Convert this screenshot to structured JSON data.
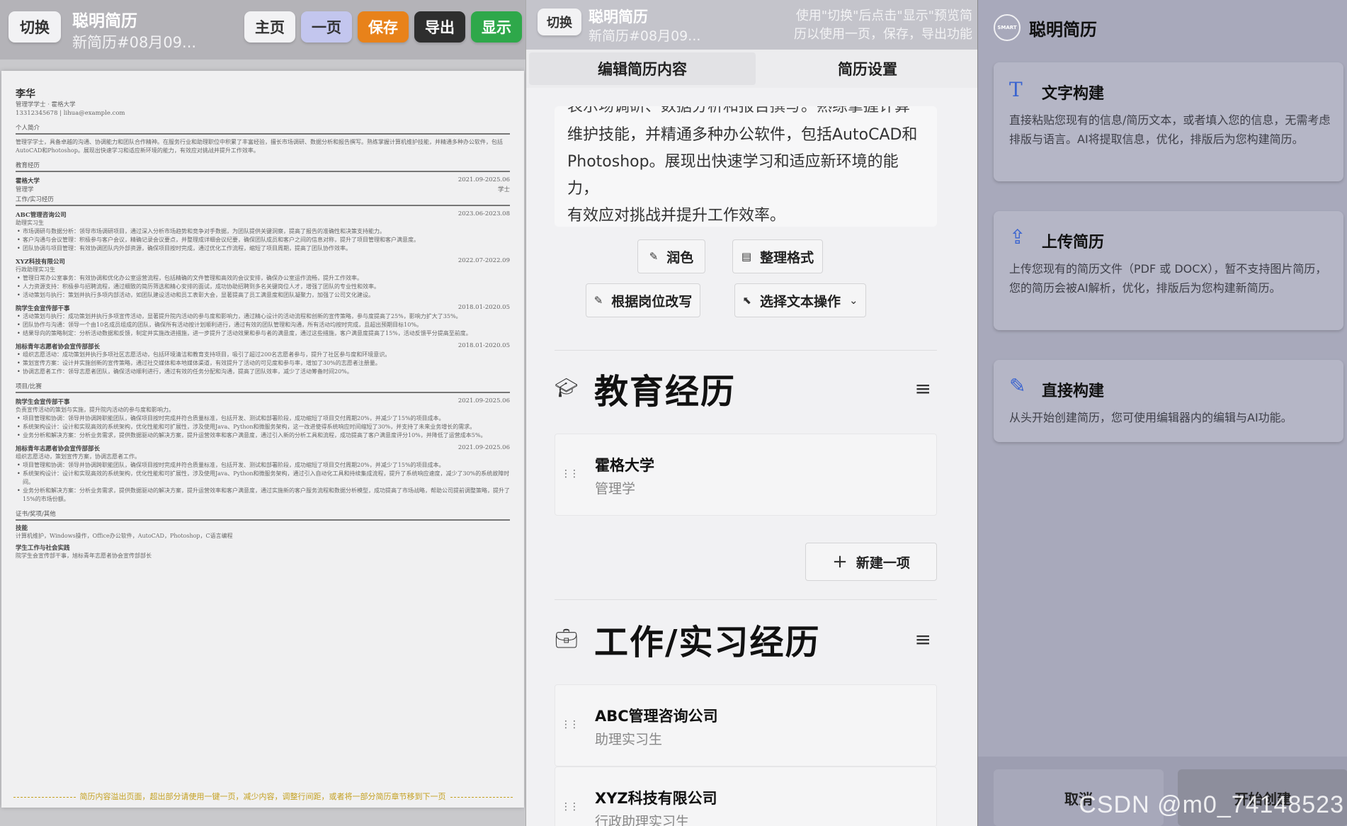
{
  "colors": {
    "save": "#e8821a",
    "export": "#2e2e2e",
    "show": "#2ea84a",
    "onepage": "#c3c6ee",
    "accent_icon": "#3a64d0",
    "footer_hint": "#c4a020"
  },
  "left": {
    "switch_label": "切换",
    "app_title": "聪明简历",
    "doc_name": "新简历#08月09...",
    "btn_home": "主页",
    "btn_onepage": "一页",
    "btn_save": "保存",
    "btn_export": "导出",
    "btn_show": "显示",
    "resume": {
      "name": "李华",
      "subtitle": "管理学学士 · 霍格大学",
      "contact": "13312345678 | lihua@example.com",
      "sec_profile": "个人简介",
      "profile": "管理学学士，具备卓越的沟通、协调能力和团队合作精神。在服务行业和助理职位中积累了丰富经验，擅长市场调研、数据分析和报告撰写。熟练掌握计算机维护技能，并精通多种办公软件，包括AutoCAD和Photoshop。展现出快速学习和适应新环境的能力，有效应对挑战并提升工作效率。",
      "sec_edu": "教育经历",
      "edu": [
        {
          "school": "霍格大学",
          "date": "2021.09-2025.06",
          "major": "管理学",
          "degree": "学士"
        }
      ],
      "sec_work": "工作/实习经历",
      "jobs": [
        {
          "company": "ABC管理咨询公司",
          "date": "2023.06-2023.08",
          "role": "助理实习生",
          "bullets": [
            "市场调研与数据分析：领导市场调研项目，通过深入分析市场趋势和竞争对手数据，为团队提供关键洞察，提高了报告的准确性和决策支持能力。",
            "客户沟通与会议管理：积极参与客户会议，精确记录会议要点，并整理成详细会议纪要，确保团队成员和客户之间的信息对称，提升了项目管理和客户满意度。",
            "团队协调与项目管理：有效协调团队内外部资源，确保项目按时完成，通过优化工作流程，缩短了项目周期，提高了团队协作效率。"
          ]
        },
        {
          "company": "XYZ科技有限公司",
          "date": "2022.07-2022.09",
          "role": "行政助理实习生",
          "bullets": [
            "管理日常办公室事务：有效协调和优化办公室运营流程，包括精确的文件管理和高效的会议安排，确保办公室运作流畅，提升工作效率。",
            "人力资源支持：积极参与招聘流程，通过细致的简历筛选和精心安排的面试，成功协助招聘到多名关键岗位人才，增强了团队的专业性和效率。",
            "活动策划与执行：策划并执行多项内部活动，如团队建设活动和员工表彰大会，显著提高了员工满意度和团队凝聚力，加强了公司文化建设。"
          ]
        },
        {
          "company": "院学生会宣传部干事",
          "date": "2018.01-2020.05",
          "role": "",
          "bullets": [
            "活动策划与执行：成功策划并执行多项宣传活动，显著提升院内活动的参与度和影响力，通过精心设计的活动流程和创新的宣传策略，参与度提高了25%，影响力扩大了35%。",
            "团队协作与沟通：领导一个由10名成员组成的团队，确保所有活动按计划顺利进行，通过有效的团队管理和沟通，所有活动均按时完成，且超出预期目标10%。",
            "结果导向的策略制定：分析活动数据和反馈，制定并实施改进措施，进一步提升了活动效果和参与者的满意度，通过这些措施，客户满意度提高了15%，活动反馈平分提高至前度。"
          ]
        },
        {
          "company": "旭标青年志愿者协会宣传部部长",
          "date": "2018.01-2020.05",
          "role": "",
          "bullets": [
            "组织志愿活动：成功策划并执行多项社区志愿活动，包括环境清洁和教育支持项目，吸引了超过200名志愿者参与，提升了社区参与度和环境意识。",
            "策划宣传方案：设计并实施创新的宣传策略，通过社交媒体和本地媒体渠道，有效提升了活动的可见度和参与率，增加了30%的志愿者注册量。",
            "协调志愿者工作：领导志愿者团队，确保活动顺利进行，通过有效的任务分配和沟通，提高了团队效率，减少了活动筹备时间20%。"
          ]
        }
      ],
      "sec_project": "项目/比赛",
      "projects": [
        {
          "title": "院学生会宣传部干事",
          "date": "2021.09-2025.06",
          "desc": "负责宣传活动的策划与实施，提升院内活动的参与度和影响力。",
          "bullets": [
            "项目管理和协调：领导并协调跨职能团队，确保项目按时完成并符合质量标准，包括开发、测试和部署阶段，成功缩短了项目交付周期20%，并减少了15%的项目成本。",
            "系统架构设计：设计和实现高效的系统架构，优化性能和可扩展性，涉及使用Java、Python和微服务架构，这一改进使得系统响应时间缩短了30%，并支持了未来业务增长的需求。",
            "业务分析和解决方案：分析业务需求，提供数据驱动的解决方案，提升运营效率和客户满意度，通过引入新的分析工具和流程，成功提高了客户满意度评分10%，并降低了运营成本5%。"
          ]
        },
        {
          "title": "旭标青年志愿者协会宣传部部长",
          "date": "2021.09-2025.06",
          "desc": "组织志愿活动，策划宣传方案，协调志愿者工作。",
          "bullets": [
            "项目管理和协调：领导并协调跨职能团队，确保项目按时完成并符合质量标准，包括开发、测试和部署阶段，成功缩短了项目交付周期20%，并减少了15%的项目成本。",
            "系统架构设计：设计和实现高效的系统架构，优化性能和可扩展性，涉及使用Java、Python和微服务架构，通过引入自动化工具和持续集成流程，提升了系统响应速度，减少了30%的系统故障时间。",
            "业务分析和解决方案：分析业务需求，提供数据驱动的解决方案，提升运营效率和客户满意度，通过实施新的客户服务流程和数据分析模型，成功提高了市场战略，帮助公司提前调整策略，提升了15%的市场份额。"
          ]
        }
      ],
      "sec_cert": "证书/奖项/其他",
      "skills_title": "技能",
      "skills": "计算机维护，Windows操作，Office办公软件，AutoCAD，Photoshop，C语言编程",
      "social_title": "学生工作与社会实践",
      "social": "院学生会宣传部干事，旭标青年志愿者协会宣传部部长",
      "footer_hint": "简历内容溢出页面，超出部分请使用一键一页，减少内容，调整行间距，或者将一部分简历章节移到下一页"
    }
  },
  "middle": {
    "switch_label": "切换",
    "app_title": "聪明简历",
    "doc_name": "新简历#08月09...",
    "hint_line1": "使用\"切换\"后点击\"显示\"预览简",
    "hint_line2": "历以使用一页，保存，导出功能",
    "tab_edit": "编辑简历内容",
    "tab_settings": "简历设置",
    "text_partial": "表示场调研、数据分析和报告撰写。熟练掌握计算机",
    "text_l1": "维护技能，并精通多种办公软件，包括AutoCAD和",
    "text_l2": "Photoshop。展现出快速学习和适应新环境的能力，",
    "text_l3": "有效应对挑战并提升工作效率。",
    "btn_polish": "润色",
    "btn_format": "整理格式",
    "btn_rewrite": "根据岗位改写",
    "btn_select_ops": "选择文本操作",
    "sec_edu_title": "教育经历",
    "edu_school": "霍格大学",
    "edu_major": "管理学",
    "btn_new_item": "新建一项",
    "sec_work_title": "工作/实习经历",
    "work1_company": "ABC管理咨询公司",
    "work1_role": "助理实习生",
    "work2_company": "XYZ科技有限公司",
    "work2_role": "行政助理实习生"
  },
  "right": {
    "logo_text": "SMART",
    "title": "聪明简历",
    "options": [
      {
        "icon": "text-icon",
        "title": "文字构建",
        "desc": "直接粘贴您现有的信息/简历文本，或者填入您的信息，无需考虑排版与语言。AI将提取信息，优化，排版后为您构建简历。"
      },
      {
        "icon": "upload-icon",
        "title": "上传简历",
        "desc": "上传您现有的简历文件（PDF 或 DOCX），暂不支持图片简历，您的简历会被AI解析，优化，排版后为您构建新简历。"
      },
      {
        "icon": "pencil-icon",
        "title": "直接构建",
        "desc": "从头开始创建简历，您可使用编辑器内的编辑与AI功能。"
      }
    ],
    "btn_cancel": "取消",
    "btn_start": "开始创建",
    "watermark": "CSDN @m0_74148523"
  }
}
